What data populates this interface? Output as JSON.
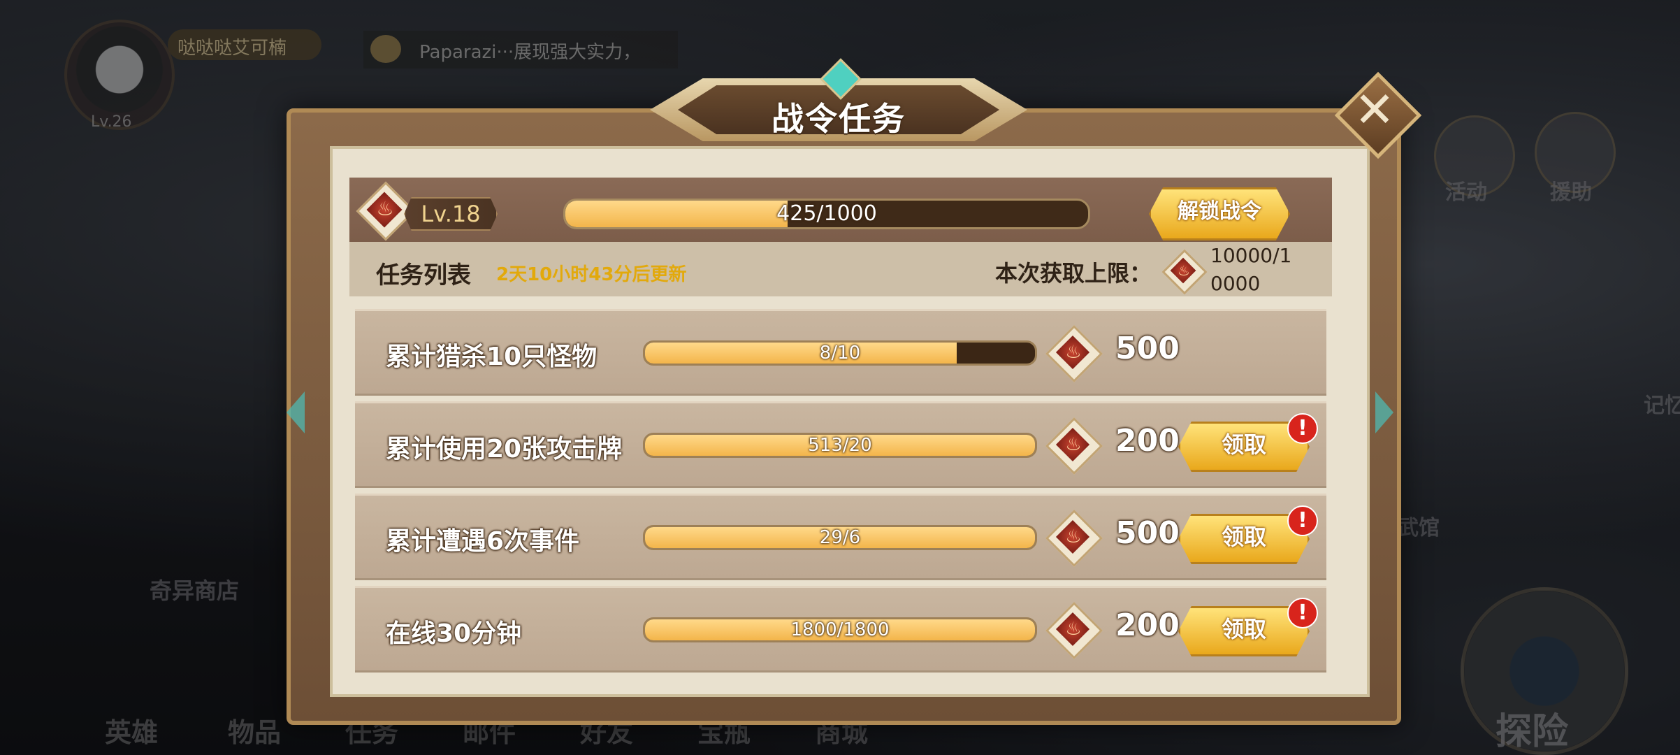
{
  "background": {
    "player_name": "哒哒哒艾可楠",
    "player_level": "Lv.26",
    "chat_text": "Paparazi···展现强大实力，",
    "right_labels": [
      "活动",
      "援助",
      "记忆",
      "武馆"
    ],
    "shop_label": "奇异商店",
    "bottom_nav": [
      "英雄",
      "物品",
      "任务",
      "邮件",
      "好友",
      "宝瓶",
      "商城"
    ],
    "explore_label": "探险"
  },
  "modal": {
    "title": "战令任务",
    "close_icon": "close-icon",
    "level_label": "Lv.18",
    "progress_text": "425/1000",
    "progress_fraction": 0.425,
    "unlock_label": "解锁战令",
    "task_list_label": "任务列表",
    "refresh_text": "2天10小时43分后更新",
    "limit_label": "本次获取上限：",
    "limit_value": "10000/10000",
    "accent_color": "#f3b54b",
    "tasks": [
      {
        "name": "累计猎杀10只怪物",
        "progress": "8/10",
        "fraction": 0.8,
        "reward": "500",
        "claimable": false,
        "claim_label": ""
      },
      {
        "name": "累计使用20张攻击牌",
        "progress": "513/20",
        "fraction": 1.0,
        "reward": "200",
        "claimable": true,
        "claim_label": "领取"
      },
      {
        "name": "累计遭遇6次事件",
        "progress": "29/6",
        "fraction": 1.0,
        "reward": "500",
        "claimable": true,
        "claim_label": "领取"
      },
      {
        "name": "在线30分钟",
        "progress": "1800/1800",
        "fraction": 1.0,
        "reward": "200",
        "claimable": true,
        "claim_label": "领取"
      }
    ],
    "alert_mark": "!"
  }
}
